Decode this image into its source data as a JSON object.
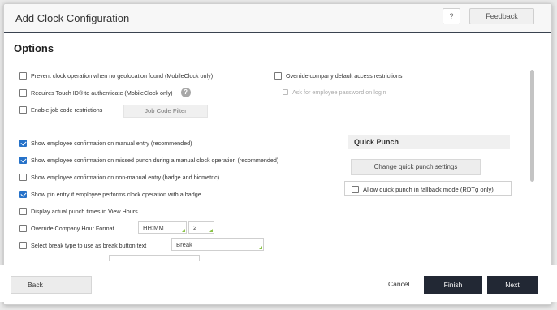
{
  "dialog": {
    "title": "Add Clock Configuration",
    "help_label": "?",
    "feedback_label": "Feedback"
  },
  "options": {
    "section_title": "Options",
    "top_left": [
      {
        "label": "Prevent clock operation when no geolocation found (MobileClock only)",
        "checked": false
      },
      {
        "label": "Requires Touch ID® to authenticate (MobileClock only)",
        "checked": false
      },
      {
        "label": "Enable job code restrictions",
        "checked": false
      }
    ],
    "help_icon": "?",
    "job_code_filter_label": "Job Code Filter",
    "top_right": [
      {
        "label": "Override company default access restrictions",
        "checked": false
      },
      {
        "label": "Ask for employee password on login",
        "checked": false,
        "disabled": true
      }
    ],
    "main": [
      {
        "label": "Show employee confirmation on manual entry (recommended)",
        "checked": true
      },
      {
        "label": "Show employee confirmation on missed punch during a manual clock operation (recommended)",
        "checked": true
      },
      {
        "label": "Show employee confirmation on non-manual entry (badge and biometric)",
        "checked": false
      },
      {
        "label": "Show pin entry if employee performs clock operation with a badge",
        "checked": true
      },
      {
        "label": "Display actual punch times in View Hours",
        "checked": false
      },
      {
        "label": "Override Company Hour Format",
        "checked": false
      },
      {
        "label": "Select break type to use as break button text",
        "checked": false
      }
    ],
    "hour_format_value": "HH:MM",
    "hour_decimals_value": "2",
    "break_type_value": "Break"
  },
  "quick_punch": {
    "title": "Quick Punch",
    "change_settings_label": "Change quick punch settings",
    "fallback_label": "Allow quick punch in fallback mode (RDTg only)",
    "fallback_checked": false
  },
  "footer": {
    "back_label": "Back",
    "cancel_label": "Cancel",
    "finish_label": "Finish",
    "next_label": "Next"
  },
  "colors": {
    "primary_dark": "#222834",
    "checkbox_blue": "#2672c9",
    "header_border": "#3a4350"
  }
}
